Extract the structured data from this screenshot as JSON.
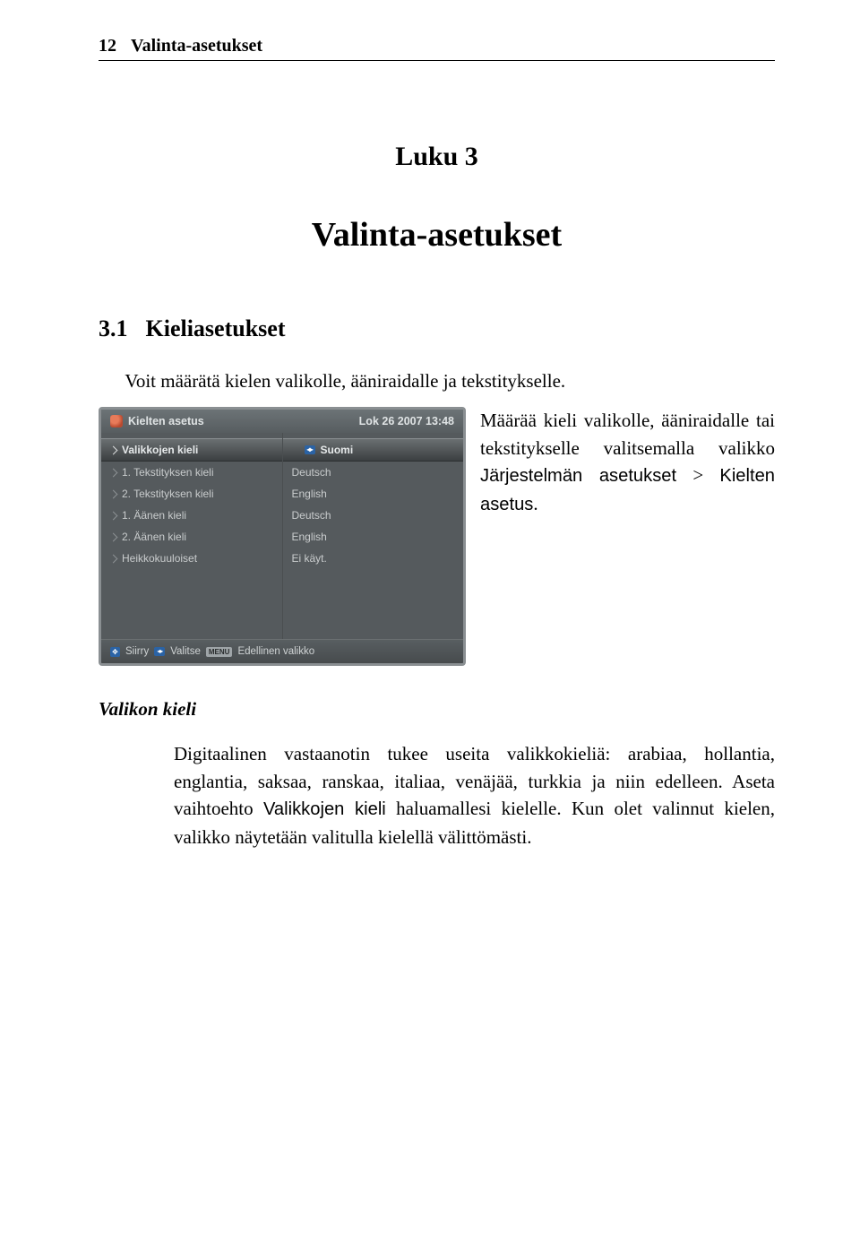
{
  "header": {
    "page_number": "12",
    "running_title": "Valinta-asetukset"
  },
  "chapter": {
    "label": "Luku 3",
    "title": "Valinta-asetukset"
  },
  "section": {
    "number": "3.1",
    "title": "Kieliasetukset"
  },
  "intro_para": "Voit määrätä kielen valikolle, ääniraidalle ja tekstitykselle.",
  "side_para": {
    "line1": "Määrää kieli valikolle, ääniraidalle tai tekstitykselle valitsemalla valikko ",
    "menu_path1": "Järjestelmän asetukset",
    "sep": " > ",
    "menu_path2": "Kielten asetus",
    "tail": "."
  },
  "figure": {
    "title": "Kielten asetus",
    "timestamp": "Lok 26 2007 13:48",
    "left_items": [
      {
        "label": "Valikkojen kieli",
        "selected": true
      },
      {
        "label": "1. Tekstityksen kieli",
        "selected": false
      },
      {
        "label": "2. Tekstityksen kieli",
        "selected": false
      },
      {
        "label": "1. Äänen kieli",
        "selected": false
      },
      {
        "label": "2. Äänen kieli",
        "selected": false
      },
      {
        "label": "Heikkokuuloiset",
        "selected": false
      }
    ],
    "right_items": [
      {
        "label": "Suomi",
        "selected": true
      },
      {
        "label": "Deutsch",
        "selected": false
      },
      {
        "label": "English",
        "selected": false
      },
      {
        "label": "Deutsch",
        "selected": false
      },
      {
        "label": "English",
        "selected": false
      },
      {
        "label": "Ei käyt.",
        "selected": false
      }
    ],
    "footer": {
      "move": "Siirry",
      "select": "Valitse",
      "menu_label": "MENU",
      "back": "Edellinen valikko"
    }
  },
  "subheading": "Valikon kieli",
  "body_para": {
    "p1": "Digitaalinen vastaanotin tukee useita valikkokieliä: arabiaa, hollantia, englantia, saksaa, ranskaa, italiaa, venäjää, turkkia ja niin edelleen. Aseta vaihtoehto ",
    "option": "Valikkojen kieli",
    "p2": " haluamallesi kielelle. Kun olet valinnut kielen, valikko näytetään valitulla kielellä välittömästi."
  }
}
